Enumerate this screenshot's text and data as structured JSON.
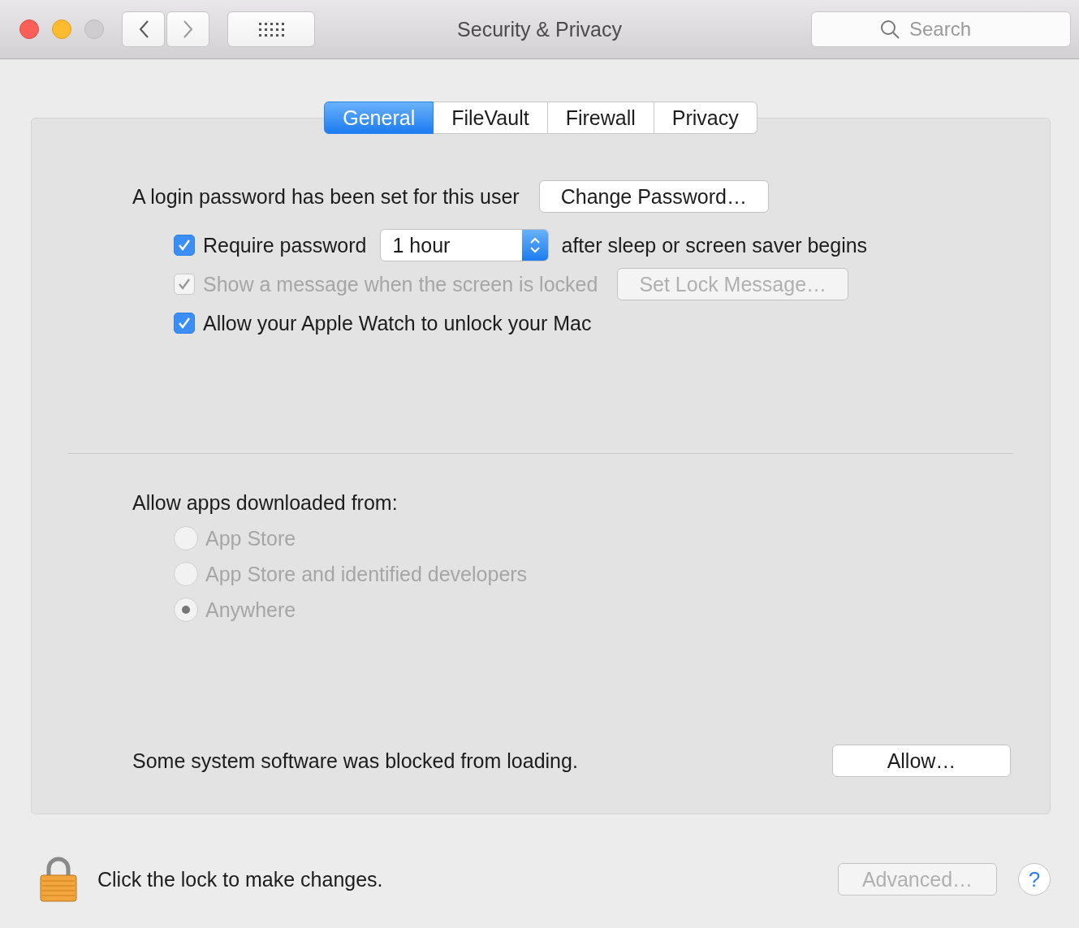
{
  "window": {
    "title": "Security & Privacy"
  },
  "toolbar": {
    "search": {
      "placeholder": "Search"
    }
  },
  "tabs": [
    {
      "label": "General",
      "selected": true
    },
    {
      "label": "FileVault",
      "selected": false
    },
    {
      "label": "Firewall",
      "selected": false
    },
    {
      "label": "Privacy",
      "selected": false
    }
  ],
  "password": {
    "label": "A login password has been set for this user",
    "button": "Change Password…"
  },
  "options": [
    {
      "kind": "popup",
      "label": "Require password",
      "checked": true,
      "disabled": false,
      "value": "1 hour",
      "suffix": "after sleep or screen saver begins"
    },
    {
      "kind": "button",
      "label": "Show a message when the screen is locked",
      "checked": true,
      "disabled": true,
      "button": "Set Lock Message…"
    },
    {
      "kind": "plain",
      "label": "Allow your Apple Watch to unlock your Mac",
      "checked": true,
      "disabled": false
    }
  ],
  "downloads": {
    "label": "Allow apps downloaded from:",
    "choices": [
      {
        "label": "App Store",
        "selected": false,
        "disabled": true
      },
      {
        "label": "App Store and identified developers",
        "selected": false,
        "disabled": true
      },
      {
        "label": "Anywhere",
        "selected": true,
        "disabled": true
      }
    ]
  },
  "blocked": {
    "text": "Some system software was blocked from loading.",
    "button": "Allow…"
  },
  "footer": {
    "lock_text": "Click the lock to make changes.",
    "advanced": {
      "label": "Advanced…",
      "disabled": true
    },
    "help": "?"
  }
}
